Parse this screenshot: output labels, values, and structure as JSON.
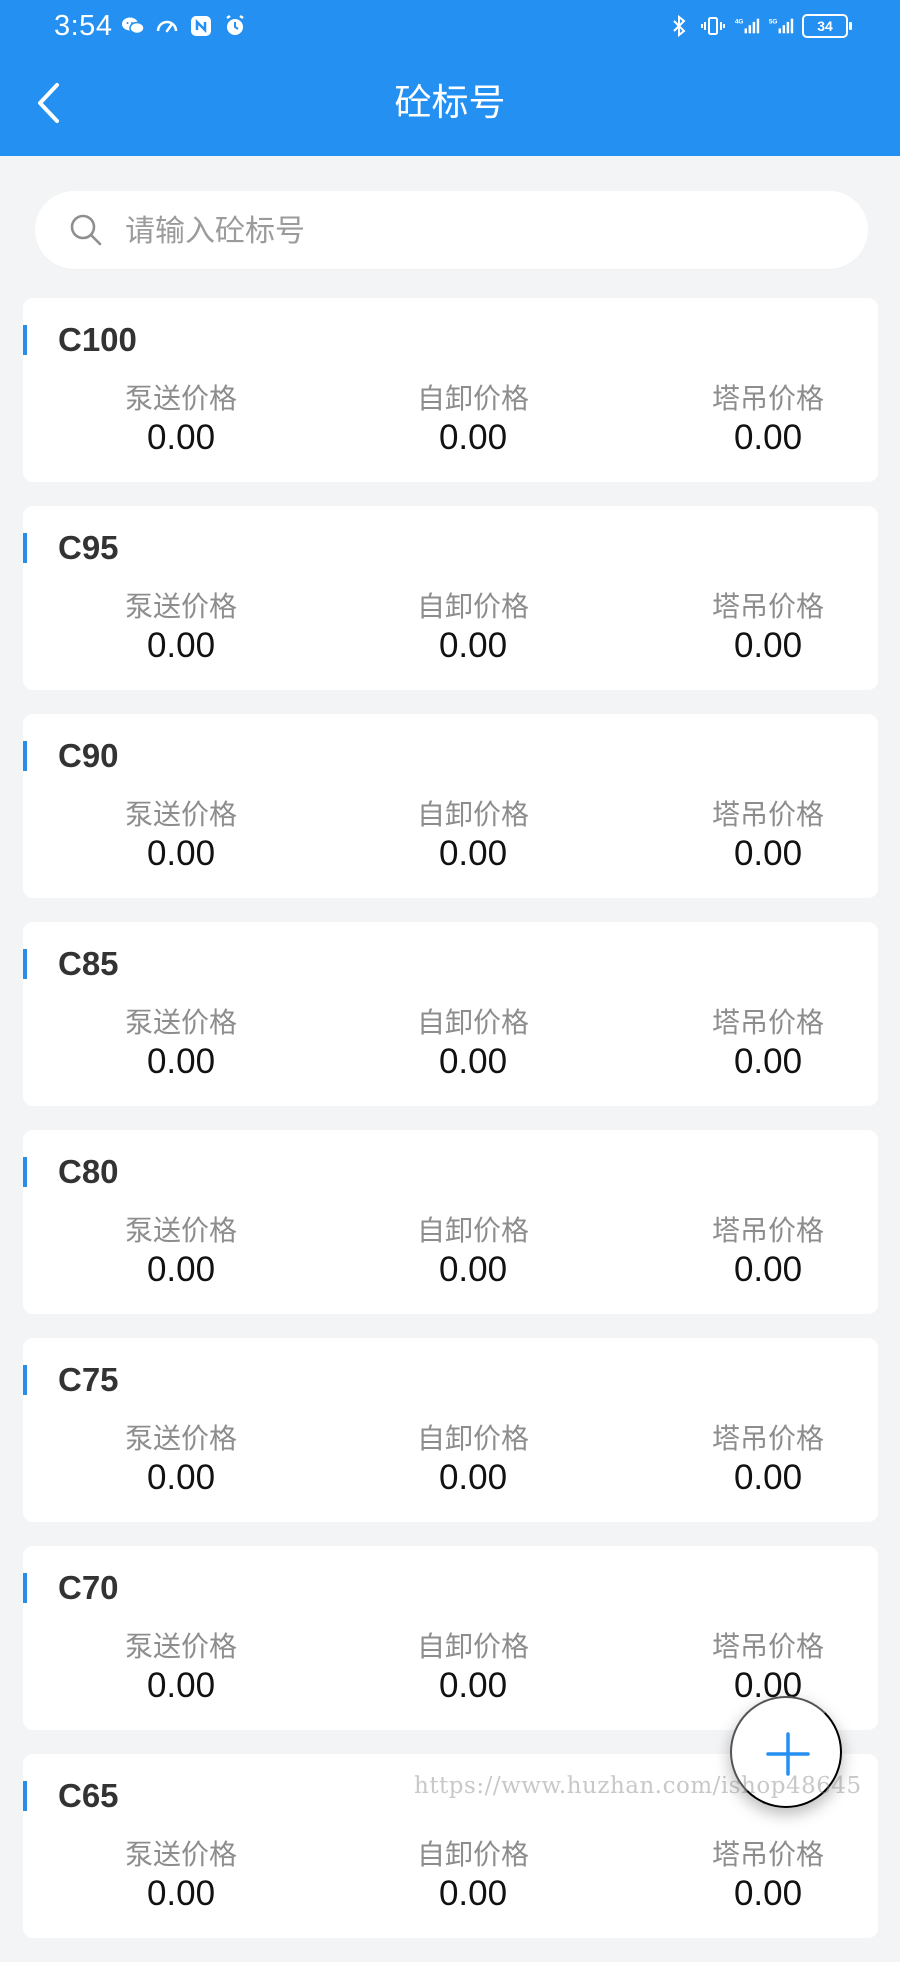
{
  "status_bar": {
    "time": "3:54",
    "battery": "34",
    "icons_left": [
      "wechat-icon",
      "speed-icon",
      "nfc-icon",
      "alarm-icon"
    ],
    "icons_right": [
      "bluetooth-icon",
      "vibrate-icon",
      "signal-4g-icon",
      "signal-5g-icon"
    ]
  },
  "nav": {
    "title": "砼标号",
    "back_icon": "chevron-left-icon"
  },
  "search": {
    "placeholder": "请输入砼标号",
    "value": ""
  },
  "cards": [
    {
      "grade": "C100",
      "prices": [
        {
          "label": "泵送价格",
          "value": "0.00"
        },
        {
          "label": "自卸价格",
          "value": "0.00"
        },
        {
          "label": "塔吊价格",
          "value": "0.00"
        }
      ]
    },
    {
      "grade": "C95",
      "prices": [
        {
          "label": "泵送价格",
          "value": "0.00"
        },
        {
          "label": "自卸价格",
          "value": "0.00"
        },
        {
          "label": "塔吊价格",
          "value": "0.00"
        }
      ]
    },
    {
      "grade": "C90",
      "prices": [
        {
          "label": "泵送价格",
          "value": "0.00"
        },
        {
          "label": "自卸价格",
          "value": "0.00"
        },
        {
          "label": "塔吊价格",
          "value": "0.00"
        }
      ]
    },
    {
      "grade": "C85",
      "prices": [
        {
          "label": "泵送价格",
          "value": "0.00"
        },
        {
          "label": "自卸价格",
          "value": "0.00"
        },
        {
          "label": "塔吊价格",
          "value": "0.00"
        }
      ]
    },
    {
      "grade": "C80",
      "prices": [
        {
          "label": "泵送价格",
          "value": "0.00"
        },
        {
          "label": "自卸价格",
          "value": "0.00"
        },
        {
          "label": "塔吊价格",
          "value": "0.00"
        }
      ]
    },
    {
      "grade": "C75",
      "prices": [
        {
          "label": "泵送价格",
          "value": "0.00"
        },
        {
          "label": "自卸价格",
          "value": "0.00"
        },
        {
          "label": "塔吊价格",
          "value": "0.00"
        }
      ]
    },
    {
      "grade": "C70",
      "prices": [
        {
          "label": "泵送价格",
          "value": "0.00"
        },
        {
          "label": "自卸价格",
          "value": "0.00"
        },
        {
          "label": "塔吊价格",
          "value": "0.00"
        }
      ]
    },
    {
      "grade": "C65",
      "prices": [
        {
          "label": "泵送价格",
          "value": "0.00"
        },
        {
          "label": "自卸价格",
          "value": "0.00"
        },
        {
          "label": "塔吊价格",
          "value": "0.00"
        }
      ]
    }
  ],
  "fab": {
    "icon": "plus-icon"
  },
  "watermark": "https://www.huzhan.com/ishop48645",
  "colors": {
    "primary": "#2490f2",
    "accent_bar": "#2a8be8",
    "page_background": "#f3f4f6",
    "card_background": "#ffffff",
    "label_text": "#8d8d8d",
    "value_text": "#111111",
    "title_text": "#333333"
  }
}
